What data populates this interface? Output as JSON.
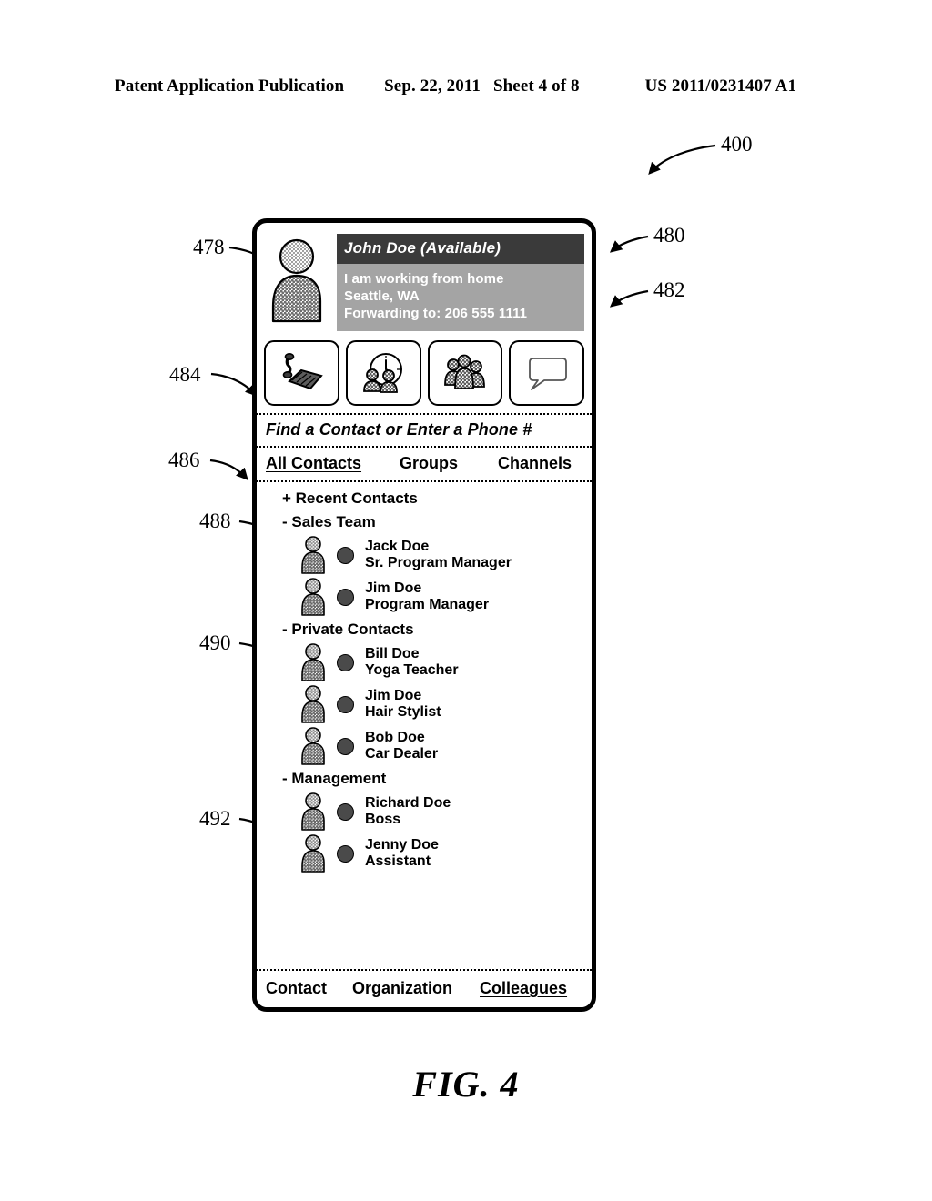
{
  "page_header": {
    "publication": "Patent Application Publication",
    "date": "Sep. 22, 2011",
    "sheet": "Sheet 4 of 8",
    "patent_number": "US 2011/0231407 A1"
  },
  "figure": {
    "caption": "FIG. 4"
  },
  "reference_numerals": [
    {
      "id": "400",
      "label": "400"
    },
    {
      "id": "478",
      "label": "478"
    },
    {
      "id": "480",
      "label": "480"
    },
    {
      "id": "482",
      "label": "482"
    },
    {
      "id": "484",
      "label": "484"
    },
    {
      "id": "486",
      "label": "486"
    },
    {
      "id": "488",
      "label": "488"
    },
    {
      "id": "490",
      "label": "490"
    },
    {
      "id": "492",
      "label": "492"
    }
  ],
  "device": {
    "profile": {
      "avatar_icon": "user-silhouette-icon",
      "name_line": "John Doe (Available)",
      "status_lines": [
        "I am working from home",
        "Seattle, WA",
        "Forwarding to: 206 555 1111"
      ]
    },
    "toolbar": [
      {
        "icon": "desk-phone-icon",
        "name": "phone-button"
      },
      {
        "icon": "meeting-clock-icon",
        "name": "meeting-button"
      },
      {
        "icon": "group-people-icon",
        "name": "group-button"
      },
      {
        "icon": "chat-bubble-icon",
        "name": "chat-button"
      }
    ],
    "search": {
      "placeholder": "Find a Contact or Enter a Phone #",
      "value": ""
    },
    "top_tabs": [
      {
        "label": "All Contacts",
        "active": true
      },
      {
        "label": "Groups",
        "active": false
      },
      {
        "label": "Channels",
        "active": false
      }
    ],
    "groups": [
      {
        "label": "+ Recent Contacts",
        "expanded": false,
        "contacts": []
      },
      {
        "label": "- Sales Team",
        "expanded": true,
        "contacts": [
          {
            "name": "Jack Doe",
            "title": "Sr. Program Manager",
            "presence": "#4a4a4a"
          },
          {
            "name": "Jim Doe",
            "title": "Program Manager",
            "presence": "#4a4a4a"
          }
        ]
      },
      {
        "label": "- Private Contacts",
        "expanded": true,
        "contacts": [
          {
            "name": "Bill Doe",
            "title": "Yoga Teacher",
            "presence": "#4a4a4a"
          },
          {
            "name": "Jim Doe",
            "title": "Hair Stylist",
            "presence": "#4a4a4a"
          },
          {
            "name": "Bob Doe",
            "title": "Car Dealer",
            "presence": "#4a4a4a"
          }
        ]
      },
      {
        "label": "- Management",
        "expanded": true,
        "contacts": [
          {
            "name": "Richard Doe",
            "title": "Boss",
            "presence": "#4a4a4a"
          },
          {
            "name": "Jenny Doe",
            "title": "Assistant",
            "presence": "#4a4a4a"
          }
        ]
      }
    ],
    "bottom_tabs": [
      {
        "label": "Contact",
        "active": false
      },
      {
        "label": "Organization",
        "active": false
      },
      {
        "label": "Colleagues",
        "active": true
      }
    ]
  },
  "colors": {
    "name_bar": "#3a3a3a",
    "status_bar": "#a4a4a4",
    "presence_dot": "#4a4a4a",
    "ink": "#000000",
    "paper": "#ffffff"
  }
}
